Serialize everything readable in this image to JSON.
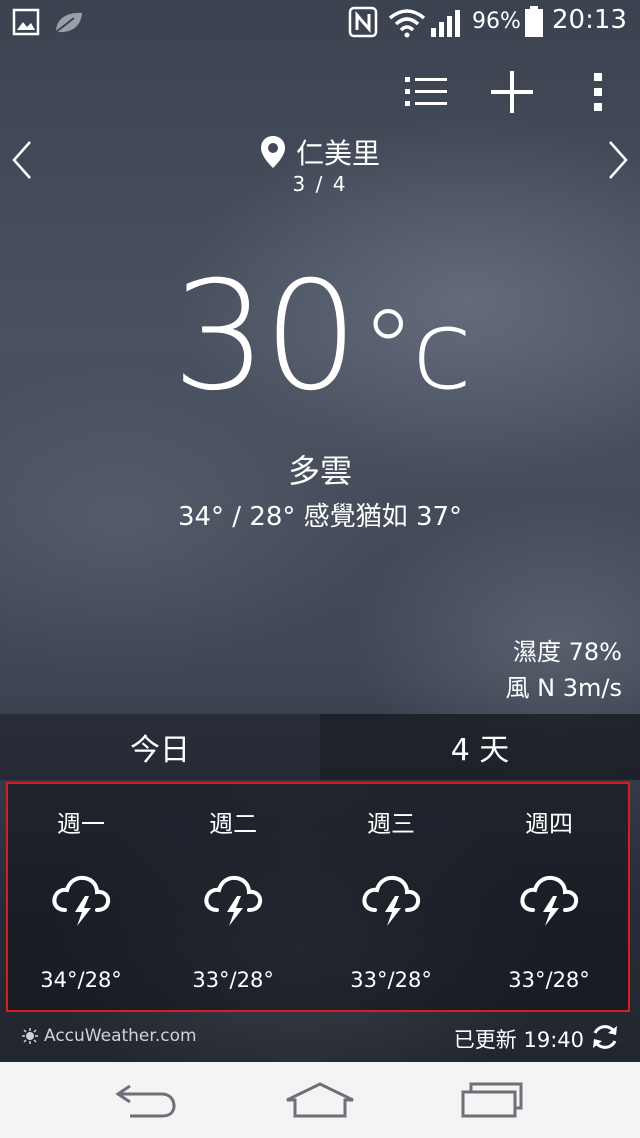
{
  "status_bar": {
    "battery": "96%",
    "time": "20:13",
    "icons": [
      "gallery-icon",
      "leaf-icon",
      "nfc-icon",
      "wifi-icon",
      "signal-icon",
      "battery-icon"
    ]
  },
  "toolbar": {
    "icons": [
      "list-icon",
      "add-icon",
      "more-icon"
    ]
  },
  "location": {
    "name": "仁美里",
    "page": "3 / 4"
  },
  "current": {
    "temperature": "30",
    "unit": "°c",
    "condition": "多雲",
    "range": "34° / 28° 感覺猶如 37°",
    "humidity": "濕度 78%",
    "wind": "風 N 3m/s"
  },
  "tabs": [
    {
      "label": "今日",
      "selected": false
    },
    {
      "label": "4 天",
      "selected": true
    }
  ],
  "forecast": [
    {
      "day": "週一",
      "icon": "thunderstorm-icon",
      "temps": "34°/28°"
    },
    {
      "day": "週二",
      "icon": "thunderstorm-icon",
      "temps": "33°/28°"
    },
    {
      "day": "週三",
      "icon": "thunderstorm-icon",
      "temps": "33°/28°"
    },
    {
      "day": "週四",
      "icon": "thunderstorm-icon",
      "temps": "33°/28°"
    }
  ],
  "footer": {
    "provider": "AccuWeather.com",
    "updated": "已更新 19:40"
  },
  "nav_bar": {
    "icons": [
      "back-icon",
      "home-icon",
      "recents-icon"
    ]
  },
  "colors": {
    "highlight_border": "#d51d22",
    "nav_bar_bg": "#f4f4f4"
  }
}
